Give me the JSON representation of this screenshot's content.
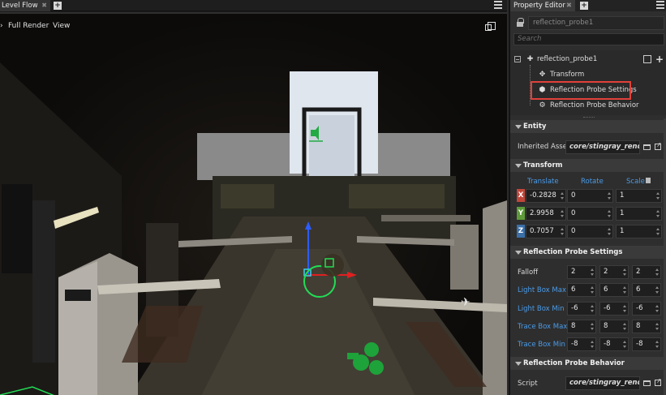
{
  "level_flow": {
    "tab_label": "Level Flow",
    "tab_close": "✖",
    "tab_add": "+",
    "toolbar": {
      "left_glyph": "›",
      "full_render": "Full Render",
      "view": "View"
    }
  },
  "property_editor": {
    "tab_label": "Property Editor",
    "tab_close": "✖",
    "tab_add": "+",
    "object_name": "reflection_probe1",
    "search_placeholder": "Search",
    "tree": {
      "root": "reflection_probe1",
      "children": [
        "Transform",
        "Reflection Probe Settings",
        "Reflection Probe Behavior"
      ],
      "highlighted": "Reflection Probe Settings"
    },
    "sections": {
      "entity": {
        "title": "Entity",
        "inherited_asset_label": "Inherited Asset",
        "inherited_asset_value": "core/stingray_renderer/"
      },
      "transform": {
        "title": "Transform",
        "headers": [
          "Translate",
          "Rotate",
          "Scale"
        ],
        "rows": [
          {
            "axis": "X",
            "color": "#c0463a",
            "translate": "-0.2828",
            "rotate": "0",
            "scale": "1"
          },
          {
            "axis": "Y",
            "color": "#5e9a3a",
            "translate": "2.9958",
            "rotate": "0",
            "scale": "1"
          },
          {
            "axis": "Z",
            "color": "#3a6fa8",
            "translate": "0.7057",
            "rotate": "0",
            "scale": "1"
          }
        ]
      },
      "reflection_probe_settings": {
        "title": "Reflection Probe Settings",
        "rows": [
          {
            "label": "Falloff",
            "blue": false,
            "values": [
              "2",
              "2",
              "2"
            ]
          },
          {
            "label": "Light Box Max",
            "blue": true,
            "values": [
              "6",
              "6",
              "6"
            ]
          },
          {
            "label": "Light Box Min",
            "blue": true,
            "values": [
              "-6",
              "-6",
              "-6"
            ]
          },
          {
            "label": "Trace Box Max",
            "blue": true,
            "values": [
              "8",
              "8",
              "8"
            ]
          },
          {
            "label": "Trace Box Min",
            "blue": true,
            "values": [
              "-8",
              "-8",
              "-8"
            ]
          }
        ]
      },
      "reflection_probe_behavior": {
        "title": "Reflection Probe Behavior",
        "script_label": "Script",
        "script_value": "core/stingray_renderer/"
      }
    }
  },
  "colors": {
    "highlight_border": "#e0403a",
    "label_blue": "#4a9be8",
    "axis_x": "#c0463a",
    "axis_y": "#5e9a3a",
    "axis_z": "#3a6fa8"
  }
}
